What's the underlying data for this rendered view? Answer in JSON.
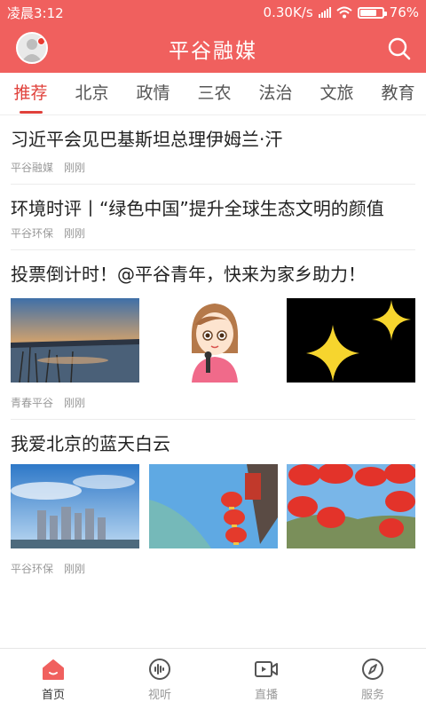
{
  "status_bar": {
    "time": "凌晨3:12",
    "network_speed": "0.30K/s",
    "battery": "76%",
    "battery_level": 0.76
  },
  "header": {
    "title": "平谷融媒",
    "accent_color": "#f0605e"
  },
  "tabs": [
    {
      "label": "推荐",
      "active": true
    },
    {
      "label": "北京"
    },
    {
      "label": "政情"
    },
    {
      "label": "三农"
    },
    {
      "label": "法治"
    },
    {
      "label": "文旅"
    },
    {
      "label": "教育"
    }
  ],
  "feed": [
    {
      "title": "习近平会见巴基斯坦总理伊姆兰·汗",
      "source": "平谷融媒",
      "time": "刚刚"
    },
    {
      "title": "环境时评丨“绿色中国”提升全球生态文明的颜值",
      "source": "平谷环保",
      "time": "刚刚"
    },
    {
      "title": "投票倒计时！@平谷青年，快来为家乡助力！",
      "source": "青春平谷",
      "time": "刚刚",
      "images": [
        "sunset-lake-photo",
        "cartoon-reporter-photo",
        "stars-graphic"
      ]
    },
    {
      "title": "我爱北京的蓝天白云",
      "source": "平谷环保",
      "time": "刚刚",
      "images": [
        "city-skyline-photo",
        "red-lanterns-sky-photo",
        "red-lanterns-mountain-photo"
      ]
    }
  ],
  "tabbar": [
    {
      "label": "首页",
      "icon": "home-icon",
      "active": true
    },
    {
      "label": "视听",
      "icon": "audio-wave-icon"
    },
    {
      "label": "直播",
      "icon": "video-camera-icon"
    },
    {
      "label": "服务",
      "icon": "compass-icon"
    }
  ]
}
